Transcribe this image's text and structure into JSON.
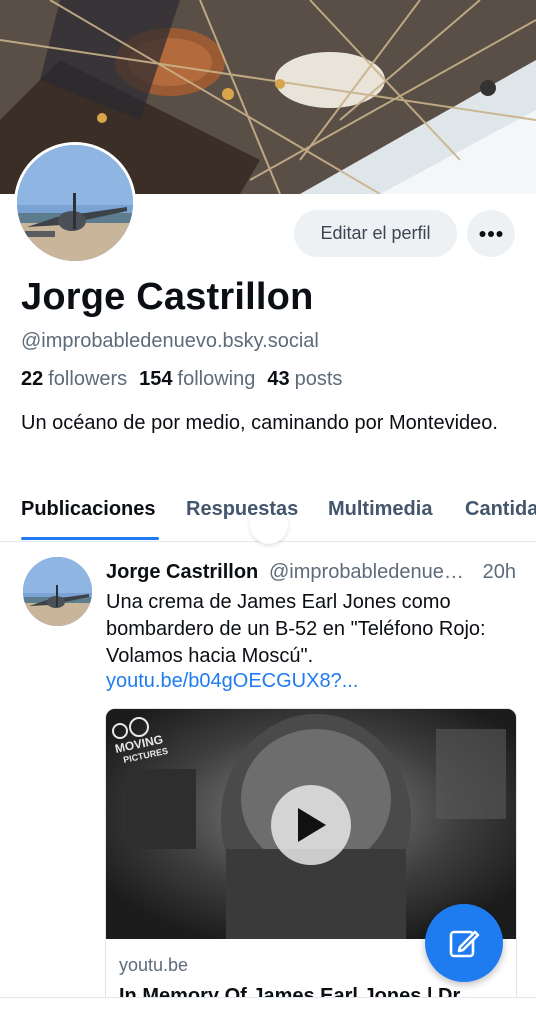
{
  "profile": {
    "display_name": "Jorge Castrillon",
    "handle": "@improbabledenuevo.bsky.social",
    "followers_count": "22",
    "followers_label": "followers",
    "following_count": "154",
    "following_label": "following",
    "posts_count": "43",
    "posts_label": "posts",
    "bio": "Un océano de por medio, caminando por Montevideo.",
    "edit_button_label": "Editar el perfil"
  },
  "tabs": [
    {
      "label": "Publicaciones",
      "active": true
    },
    {
      "label": "Respuestas",
      "active": false
    },
    {
      "label": "Multimedia",
      "active": false
    },
    {
      "label": "Cantida",
      "active": false
    }
  ],
  "post": {
    "author": "Jorge Castrillon",
    "handle": "@improbabledenuev...",
    "time": "20h",
    "text": "Una crema de James Earl Jones como bombardero de un B-52 en \"Teléfono Rojo: Volamos hacia Moscú\".",
    "link": "youtu.be/b04gOECGUX8?...",
    "card": {
      "domain": "youtu.be",
      "title": "In Memory Of James Earl Jones | Dr."
    }
  },
  "colors": {
    "accent": "#1f7cf0",
    "button_bg": "#eef1f4",
    "muted_text": "#5d6b7a"
  },
  "icons": {
    "more": "more-horizontal-icon",
    "compose": "compose-icon",
    "play": "play-icon"
  }
}
